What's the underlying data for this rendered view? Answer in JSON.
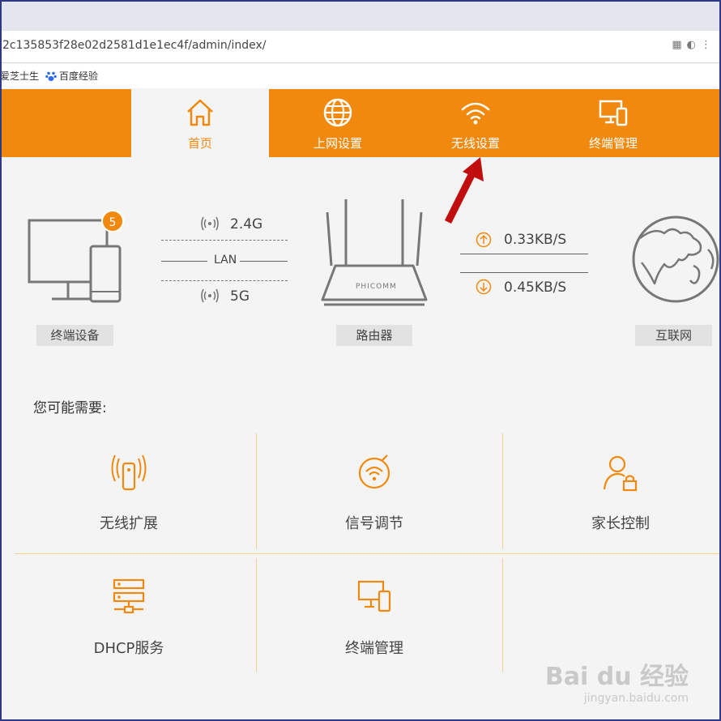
{
  "browser": {
    "url": "2c135853f28e02d2581d1e1ec4f/admin/index/",
    "bookmarks": [
      {
        "label": "爱芝士生"
      },
      {
        "label": "百度经验"
      }
    ]
  },
  "nav": {
    "items": [
      {
        "label": "首页",
        "icon": "home-icon",
        "active": true
      },
      {
        "label": "上网设置",
        "icon": "globe-icon"
      },
      {
        "label": "无线设置",
        "icon": "wifi-icon"
      },
      {
        "label": "终端管理",
        "icon": "devices-icon"
      }
    ]
  },
  "status": {
    "terminal_count": "5",
    "band_24": "2.4G",
    "lan": "LAN",
    "band_5": "5G",
    "router_brand": "PHICOMM",
    "upload_speed": "0.33KB/S",
    "download_speed": "0.45KB/S",
    "labels": {
      "devices": "终端设备",
      "router": "路由器",
      "internet": "互联网"
    }
  },
  "quick": {
    "title": "您可能需要:",
    "cards": [
      {
        "label": "无线扩展",
        "icon": "wireless-extend-icon"
      },
      {
        "label": "信号调节",
        "icon": "signal-adjust-icon"
      },
      {
        "label": "家长控制",
        "icon": "parental-control-icon"
      },
      {
        "label": "DHCP服务",
        "icon": "dhcp-server-icon"
      },
      {
        "label": "终端管理",
        "icon": "device-manage-icon"
      }
    ]
  },
  "watermark": {
    "brand": "Bai du 经验",
    "site": "jingyan.baidu.com"
  },
  "colors": {
    "accent": "#f0890e",
    "annotation_arrow": "#c00d0d"
  }
}
